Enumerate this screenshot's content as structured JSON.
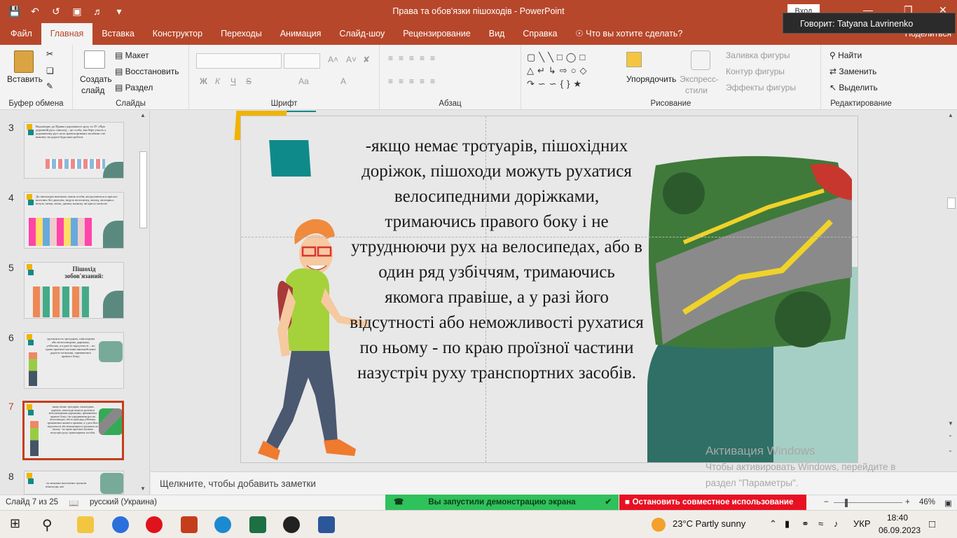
{
  "window": {
    "title": "Права та обов'язки пішоходів  -  PowerPoint",
    "signin": "Вход",
    "speaking": "Говорит: Tatyana Lavrinenko"
  },
  "tabs": [
    {
      "label": "Файл"
    },
    {
      "label": "Главная"
    },
    {
      "label": "Вставка"
    },
    {
      "label": "Конструктор"
    },
    {
      "label": "Переходы"
    },
    {
      "label": "Анимация"
    },
    {
      "label": "Слайд-шоу"
    },
    {
      "label": "Рецензирование"
    },
    {
      "label": "Вид"
    },
    {
      "label": "Справка"
    },
    {
      "label": "Что вы хотите сделать?"
    }
  ],
  "share": "Поделиться",
  "ribbon": {
    "paste": "Вставить",
    "clipboard": "Буфер обмена",
    "new_slide": "Создать",
    "new_slide2": "слайд",
    "layout": "Макет",
    "reset": "Восстановить",
    "section": "Раздел",
    "slides": "Слайды",
    "font": "Шрифт",
    "font_bold": "Ж",
    "font_italic": "К",
    "font_underline": "Ч",
    "font_strike": "S",
    "font_aa": "Aa",
    "font_a": "A",
    "paragraph": "Абзац",
    "arrange": "Упорядочить",
    "express": "Экспресс-",
    "express2": "стили",
    "fill": "Заливка фигуры",
    "outline": "Контур фигуры",
    "effects": "Эффекты фигуры",
    "drawing": "Рисование",
    "find": "Найти",
    "replace": "Заменить",
    "select": "Выделить",
    "editing": "Редактирование"
  },
  "thumbnails": [
    {
      "num": "3",
      "text": "Відповідно до Правил дорожнього руху та ЗУ «Про дорожній рух» пішохід – це особа, яка бере участь у дорожньому русі поза транспортними засобами і не виконує на дорозі будь-якої роботи."
    },
    {
      "num": "4",
      "text": "До пішоходів належать також особи, які рухаються в кріслах колісних без двигуна, ведуть велосипед, мопед, мотоцикл, везуть санки, візок, дитячу коляску чи крісло колісне."
    },
    {
      "num": "5",
      "text": "Пішохід зобов'язаний:"
    },
    {
      "num": "6",
      "text": "-рухатися по тротуарах, пішохідних або велосипедних доріжках, узбіччях, а в разі їх відсутності – по краю проїзної частини автомобільної дороги чи вулиці, тримаючись правого боку;"
    },
    {
      "num": "7",
      "text": "-якщо немає тротуарів, пішохідних доріжок, пішоходи можуть рухатися велосипедними доріжками, тримаючись правого боку і не утруднюючи рух на велосипедах, або в один ряд узбіччям, тримаючись якомога правіше, а у разі його відсутності або неможливості рухатися по ньому - по краю проїзної частини назустріч руху транспортних засобів."
    },
    {
      "num": "8",
      "text": "-за межами населених пунктів пішоходи, які"
    }
  ],
  "slide": {
    "text": "-якщо немає тротуарів, пішохідних доріжок, пішоходи можуть рухатися велосипедними доріжками, тримаючись правого боку і не утруднюючи рух на велосипедах, або в один ряд узбіччям, тримаючись якомога правіше, а у разі його відсутності або неможливості рухатися по ньому - по краю проїзної частини назустріч руху транспортних засобів."
  },
  "notes_placeholder": "Щелкните, чтобы добавить заметки",
  "watermark": {
    "title": "Активация Windows",
    "line1": "Чтобы активировать Windows, перейдите в",
    "line2": "раздел \"Параметры\"."
  },
  "status": {
    "slide_counter": "Слайд 7 из 25",
    "language": "русский (Украина)",
    "screen_share": "Вы запустили демонстрацию экрана",
    "stop_share": "Остановить совместное использование",
    "zoom": "46%"
  },
  "taskbar": {
    "weather": "23°C  Partly sunny",
    "lang": "УКР",
    "time": "18:40",
    "date": "06.09.2023"
  },
  "colors": {
    "accent": "#b7472a",
    "teal": "#0f8a8a",
    "yellow": "#f0b400",
    "green_share": "#2fc15b",
    "red_share": "#e81123"
  }
}
